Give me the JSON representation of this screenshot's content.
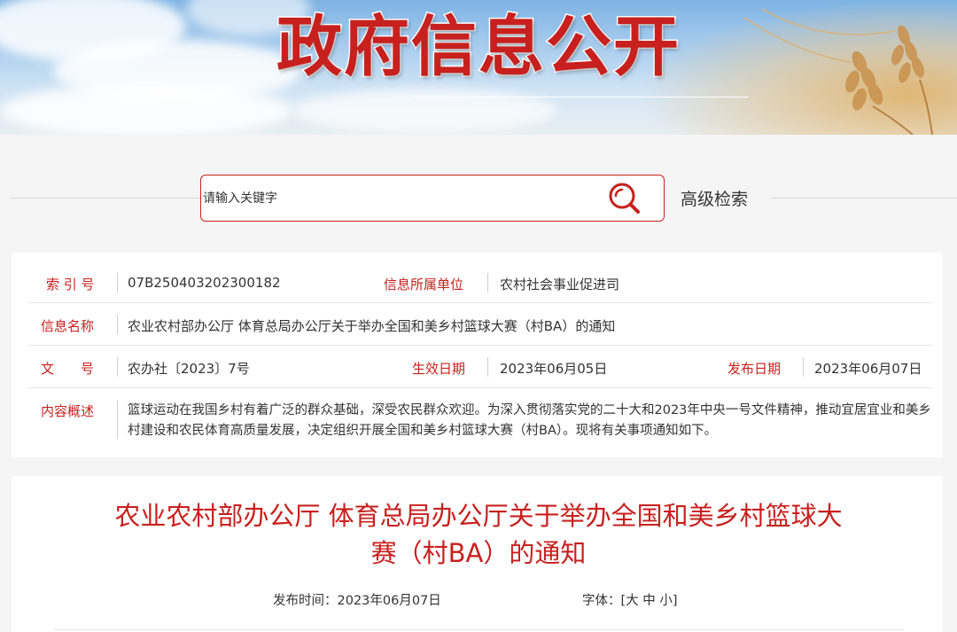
{
  "banner": {
    "title": "政府信息公开"
  },
  "search": {
    "placeholder": "请输入关键字",
    "advanced_label": "高级检索"
  },
  "meta": {
    "index_label": "索 引 号",
    "index_value": "07B250403202300182",
    "unit_label": "信息所属单位",
    "unit_value": "农村社会事业促进司",
    "name_label": "信息名称",
    "name_value": "农业农村部办公厅 体育总局办公厅关于举办全国和美乡村篮球大赛（村BA）的通知",
    "doc_label": "文　　号",
    "doc_value": "农办社〔2023〕7号",
    "effective_label": "生效日期",
    "effective_value": "2023年06月05日",
    "publish_label": "发布日期",
    "publish_value": "2023年06月07日",
    "summary_label": "内容概述",
    "summary_value": "篮球运动在我国乡村有着广泛的群众基础，深受农民群众欢迎。为深入贯彻落实党的二十大和2023年中央一号文件精神，推动宜居宜业和美乡村建设和农民体育高质量发展，决定组织开展全国和美乡村篮球大赛（村BA）。现将有关事项通知如下。"
  },
  "article": {
    "title_line1": "农业农村部办公厅 体育总局办公厅关于举办全国和美乡村篮球大",
    "title_line2": "赛（村BA）的通知",
    "pub_time_label": "发布时间：",
    "pub_time_value": "2023年06月07日",
    "font_label": "字体：",
    "font_open": "[",
    "font_large": "大",
    "font_medium": "中",
    "font_small": "小",
    "font_close": "]"
  },
  "colors": {
    "accent": "#c8201e",
    "text": "#333333",
    "background": "#f5f5f5"
  },
  "icons": {
    "search": "search-icon"
  }
}
